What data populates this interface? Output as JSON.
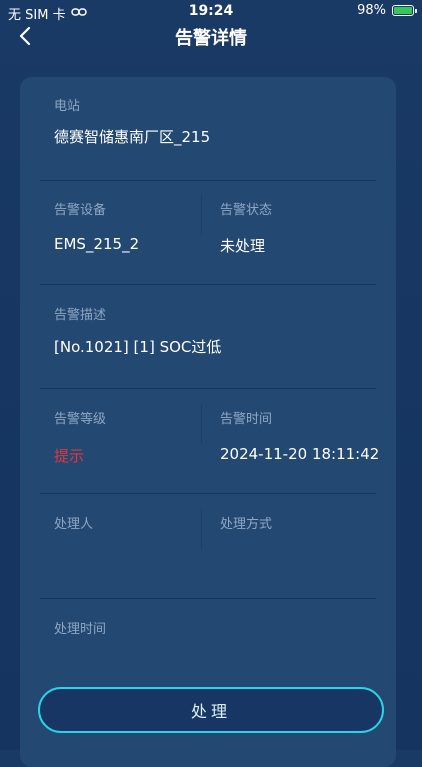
{
  "status_bar": {
    "carrier": "无 SIM 卡",
    "time": "19:24",
    "battery": "98%",
    "battery_level": 0.98
  },
  "nav": {
    "title": "告警详情"
  },
  "details": {
    "station_label": "电站",
    "station_value": "德赛智储惠南厂区_215",
    "device_label": "告警设备",
    "device_value": "EMS_215_2",
    "status_label": "告警状态",
    "status_value": "未处理",
    "description_label": "告警描述",
    "description_value": "[No.1021] [1] SOC过低",
    "level_label": "告警等级",
    "level_value": "提示",
    "time_label": "告警时间",
    "time_value": "2024-11-20 18:11:42",
    "handler_label": "处理人",
    "method_label": "处理方式",
    "handle_time_label": "处理时间"
  },
  "actions": {
    "process_label": "处理"
  },
  "colors": {
    "accent": "#2ad4e4",
    "warning": "#e0383a",
    "card": "#234872",
    "background": "#1a3a66"
  }
}
